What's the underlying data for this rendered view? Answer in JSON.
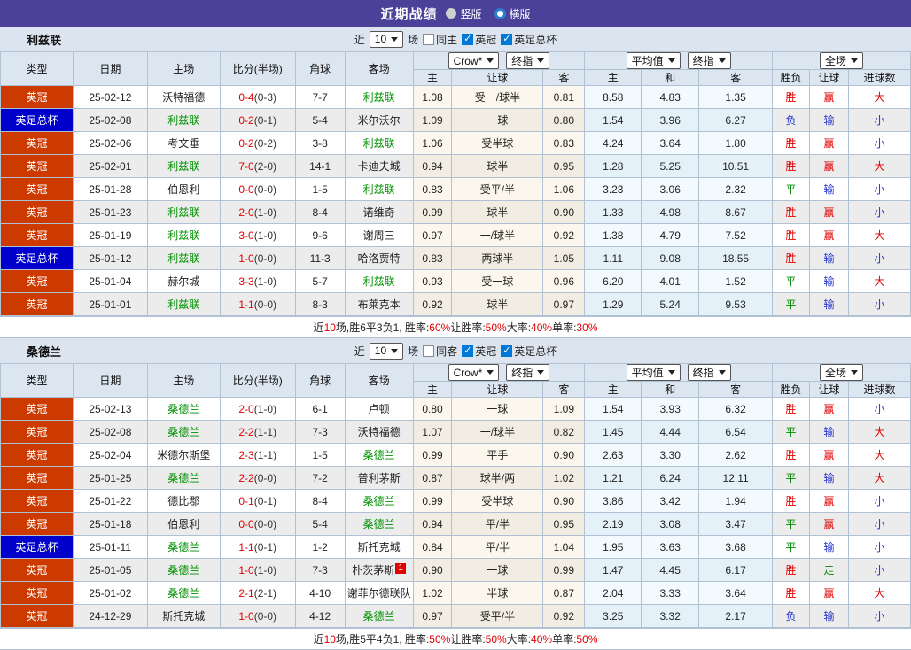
{
  "topbar": {
    "title": "近期战绩",
    "radios": [
      {
        "label": "竖版",
        "selected": false
      },
      {
        "label": "横版",
        "selected": true
      }
    ]
  },
  "colors": {
    "topbar_purple": "#4c4199",
    "league_badge": "#cc3a00",
    "cup_badge": "#0000cc",
    "win_red": "#e00000",
    "draw_green": "#008800",
    "lose_blue": "#2233cc",
    "highlight_team_green": "#009000",
    "checkbox_blue": "#0078d7"
  },
  "columns": [
    "类型",
    "日期",
    "主场",
    "比分(半场)",
    "角球",
    "客场",
    "主",
    "让球",
    "客",
    "主",
    "和",
    "客",
    "胜负",
    "让球",
    "进球数"
  ],
  "selects": {
    "odds_source": "Crow*",
    "odds_stage": "终指",
    "average": "平均值",
    "average_stage": "终指",
    "scope": "全场"
  },
  "sections": [
    {
      "team": "利兹联",
      "filter": {
        "near_label": "近",
        "count": "10",
        "games_label": "场",
        "checks": [
          {
            "label": "同主",
            "checked": false
          },
          {
            "label": "英冠",
            "checked": true
          },
          {
            "label": "英足总杯",
            "checked": true
          }
        ]
      },
      "rows": [
        {
          "comp": "英冠",
          "comp_type": "league",
          "date": "25-02-12",
          "home": "沃特福德",
          "home_hl": false,
          "score": "0-4",
          "half": "(0-3)",
          "corner": "7-7",
          "away": "利兹联",
          "away_hl": true,
          "odds": [
            "1.08",
            "受一/球半",
            "0.81",
            "8.58",
            "4.83",
            "1.35"
          ],
          "results": [
            [
              "胜",
              "r"
            ],
            [
              "赢",
              "r"
            ],
            [
              "大",
              "r"
            ]
          ]
        },
        {
          "comp": "英足总杯",
          "comp_type": "cup",
          "date": "25-02-08",
          "home": "利兹联",
          "home_hl": true,
          "score": "0-2",
          "half": "(0-1)",
          "corner": "5-4",
          "away": "米尔沃尔",
          "away_hl": false,
          "odds": [
            "1.09",
            "一球",
            "0.80",
            "1.54",
            "3.96",
            "6.27"
          ],
          "results": [
            [
              "负",
              "b"
            ],
            [
              "输",
              "b"
            ],
            [
              "小",
              "b"
            ]
          ]
        },
        {
          "comp": "英冠",
          "comp_type": "league",
          "date": "25-02-06",
          "home": "考文垂",
          "home_hl": false,
          "score": "0-2",
          "half": "(0-2)",
          "corner": "3-8",
          "away": "利兹联",
          "away_hl": true,
          "odds": [
            "1.06",
            "受半球",
            "0.83",
            "4.24",
            "3.64",
            "1.80"
          ],
          "results": [
            [
              "胜",
              "r"
            ],
            [
              "赢",
              "r"
            ],
            [
              "小",
              "b"
            ]
          ]
        },
        {
          "comp": "英冠",
          "comp_type": "league",
          "date": "25-02-01",
          "home": "利兹联",
          "home_hl": true,
          "score": "7-0",
          "half": "(2-0)",
          "corner": "14-1",
          "away": "卡迪夫城",
          "away_hl": false,
          "odds": [
            "0.94",
            "球半",
            "0.95",
            "1.28",
            "5.25",
            "10.51"
          ],
          "results": [
            [
              "胜",
              "r"
            ],
            [
              "赢",
              "r"
            ],
            [
              "大",
              "r"
            ]
          ]
        },
        {
          "comp": "英冠",
          "comp_type": "league",
          "date": "25-01-28",
          "home": "伯恩利",
          "home_hl": false,
          "score": "0-0",
          "half": "(0-0)",
          "corner": "1-5",
          "away": "利兹联",
          "away_hl": true,
          "odds": [
            "0.83",
            "受平/半",
            "1.06",
            "3.23",
            "3.06",
            "2.32"
          ],
          "results": [
            [
              "平",
              "g"
            ],
            [
              "输",
              "b"
            ],
            [
              "小",
              "b"
            ]
          ]
        },
        {
          "comp": "英冠",
          "comp_type": "league",
          "date": "25-01-23",
          "home": "利兹联",
          "home_hl": true,
          "score": "2-0",
          "half": "(1-0)",
          "corner": "8-4",
          "away": "诺维奇",
          "away_hl": false,
          "odds": [
            "0.99",
            "球半",
            "0.90",
            "1.33",
            "4.98",
            "8.67"
          ],
          "results": [
            [
              "胜",
              "r"
            ],
            [
              "赢",
              "r"
            ],
            [
              "小",
              "b"
            ]
          ]
        },
        {
          "comp": "英冠",
          "comp_type": "league",
          "date": "25-01-19",
          "home": "利兹联",
          "home_hl": true,
          "score": "3-0",
          "half": "(1-0)",
          "corner": "9-6",
          "away": "谢周三",
          "away_hl": false,
          "odds": [
            "0.97",
            "一/球半",
            "0.92",
            "1.38",
            "4.79",
            "7.52"
          ],
          "results": [
            [
              "胜",
              "r"
            ],
            [
              "赢",
              "r"
            ],
            [
              "大",
              "r"
            ]
          ]
        },
        {
          "comp": "英足总杯",
          "comp_type": "cup",
          "date": "25-01-12",
          "home": "利兹联",
          "home_hl": true,
          "score": "1-0",
          "half": "(0-0)",
          "corner": "11-3",
          "away": "哈洛贾特",
          "away_hl": false,
          "odds": [
            "0.83",
            "两球半",
            "1.05",
            "1.11",
            "9.08",
            "18.55"
          ],
          "results": [
            [
              "胜",
              "r"
            ],
            [
              "输",
              "b"
            ],
            [
              "小",
              "b"
            ]
          ]
        },
        {
          "comp": "英冠",
          "comp_type": "league",
          "date": "25-01-04",
          "home": "赫尔城",
          "home_hl": false,
          "score": "3-3",
          "half": "(1-0)",
          "corner": "5-7",
          "away": "利兹联",
          "away_hl": true,
          "odds": [
            "0.93",
            "受一球",
            "0.96",
            "6.20",
            "4.01",
            "1.52"
          ],
          "results": [
            [
              "平",
              "g"
            ],
            [
              "输",
              "b"
            ],
            [
              "大",
              "r"
            ]
          ]
        },
        {
          "comp": "英冠",
          "comp_type": "league",
          "date": "25-01-01",
          "home": "利兹联",
          "home_hl": true,
          "score": "1-1",
          "half": "(0-0)",
          "corner": "8-3",
          "away": "布莱克本",
          "away_hl": false,
          "odds": [
            "0.92",
            "球半",
            "0.97",
            "1.29",
            "5.24",
            "9.53"
          ],
          "results": [
            [
              "平",
              "g"
            ],
            [
              "输",
              "b"
            ],
            [
              "小",
              "b"
            ]
          ]
        }
      ],
      "summary": [
        [
          "近",
          "k"
        ],
        [
          "10",
          "r"
        ],
        [
          "场,胜6平3负1, 胜率:",
          "k"
        ],
        [
          "60%",
          "r"
        ],
        [
          " 让胜率:",
          "k"
        ],
        [
          "50%",
          "r"
        ],
        [
          " 大率:",
          "k"
        ],
        [
          "40%",
          "r"
        ],
        [
          " 单率:",
          "k"
        ],
        [
          "30%",
          "r"
        ]
      ]
    },
    {
      "team": "桑德兰",
      "filter": {
        "near_label": "近",
        "count": "10",
        "games_label": "场",
        "checks": [
          {
            "label": "同客",
            "checked": false
          },
          {
            "label": "英冠",
            "checked": true
          },
          {
            "label": "英足总杯",
            "checked": true
          }
        ]
      },
      "rows": [
        {
          "comp": "英冠",
          "comp_type": "league",
          "date": "25-02-13",
          "home": "桑德兰",
          "home_hl": true,
          "score": "2-0",
          "half": "(1-0)",
          "corner": "6-1",
          "away": "卢顿",
          "away_hl": false,
          "odds": [
            "0.80",
            "一球",
            "1.09",
            "1.54",
            "3.93",
            "6.32"
          ],
          "results": [
            [
              "胜",
              "r"
            ],
            [
              "赢",
              "r"
            ],
            [
              "小",
              "b"
            ]
          ]
        },
        {
          "comp": "英冠",
          "comp_type": "league",
          "date": "25-02-08",
          "home": "桑德兰",
          "home_hl": true,
          "score": "2-2",
          "half": "(1-1)",
          "corner": "7-3",
          "away": "沃特福德",
          "away_hl": false,
          "odds": [
            "1.07",
            "一/球半",
            "0.82",
            "1.45",
            "4.44",
            "6.54"
          ],
          "results": [
            [
              "平",
              "g"
            ],
            [
              "输",
              "b"
            ],
            [
              "大",
              "r"
            ]
          ]
        },
        {
          "comp": "英冠",
          "comp_type": "league",
          "date": "25-02-04",
          "home": "米德尔斯堡",
          "home_hl": false,
          "score": "2-3",
          "half": "(1-1)",
          "corner": "1-5",
          "away": "桑德兰",
          "away_hl": true,
          "odds": [
            "0.99",
            "平手",
            "0.90",
            "2.63",
            "3.30",
            "2.62"
          ],
          "results": [
            [
              "胜",
              "r"
            ],
            [
              "赢",
              "r"
            ],
            [
              "大",
              "r"
            ]
          ]
        },
        {
          "comp": "英冠",
          "comp_type": "league",
          "date": "25-01-25",
          "home": "桑德兰",
          "home_hl": true,
          "score": "2-2",
          "half": "(0-0)",
          "corner": "7-2",
          "away": "普利茅斯",
          "away_hl": false,
          "odds": [
            "0.87",
            "球半/两",
            "1.02",
            "1.21",
            "6.24",
            "12.11"
          ],
          "results": [
            [
              "平",
              "g"
            ],
            [
              "输",
              "b"
            ],
            [
              "大",
              "r"
            ]
          ]
        },
        {
          "comp": "英冠",
          "comp_type": "league",
          "date": "25-01-22",
          "home": "德比郡",
          "home_hl": false,
          "score": "0-1",
          "half": "(0-1)",
          "corner": "8-4",
          "away": "桑德兰",
          "away_hl": true,
          "odds": [
            "0.99",
            "受半球",
            "0.90",
            "3.86",
            "3.42",
            "1.94"
          ],
          "results": [
            [
              "胜",
              "r"
            ],
            [
              "赢",
              "r"
            ],
            [
              "小",
              "b"
            ]
          ]
        },
        {
          "comp": "英冠",
          "comp_type": "league",
          "date": "25-01-18",
          "home": "伯恩利",
          "home_hl": false,
          "score": "0-0",
          "half": "(0-0)",
          "corner": "5-4",
          "away": "桑德兰",
          "away_hl": true,
          "odds": [
            "0.94",
            "平/半",
            "0.95",
            "2.19",
            "3.08",
            "3.47"
          ],
          "results": [
            [
              "平",
              "g"
            ],
            [
              "赢",
              "r"
            ],
            [
              "小",
              "b"
            ]
          ]
        },
        {
          "comp": "英足总杯",
          "comp_type": "cup",
          "date": "25-01-11",
          "home": "桑德兰",
          "home_hl": true,
          "score": "1-1",
          "half": "(0-1)",
          "corner": "1-2",
          "away": "斯托克城",
          "away_hl": false,
          "odds": [
            "0.84",
            "平/半",
            "1.04",
            "1.95",
            "3.63",
            "3.68"
          ],
          "results": [
            [
              "平",
              "g"
            ],
            [
              "输",
              "b"
            ],
            [
              "小",
              "b"
            ]
          ]
        },
        {
          "comp": "英冠",
          "comp_type": "league",
          "date": "25-01-05",
          "home": "桑德兰",
          "home_hl": true,
          "score": "1-0",
          "half": "(1-0)",
          "corner": "7-3",
          "away": "朴茨茅斯",
          "away_hl": false,
          "away_badge": "1",
          "odds": [
            "0.90",
            "一球",
            "0.99",
            "1.47",
            "4.45",
            "6.17"
          ],
          "results": [
            [
              "胜",
              "r"
            ],
            [
              "走",
              "g"
            ],
            [
              "小",
              "b"
            ]
          ]
        },
        {
          "comp": "英冠",
          "comp_type": "league",
          "date": "25-01-02",
          "home": "桑德兰",
          "home_hl": true,
          "score": "2-1",
          "half": "(2-1)",
          "corner": "4-10",
          "away": "谢菲尔德联队",
          "away_hl": false,
          "odds": [
            "1.02",
            "半球",
            "0.87",
            "2.04",
            "3.33",
            "3.64"
          ],
          "results": [
            [
              "胜",
              "r"
            ],
            [
              "赢",
              "r"
            ],
            [
              "大",
              "r"
            ]
          ]
        },
        {
          "comp": "英冠",
          "comp_type": "league",
          "date": "24-12-29",
          "home": "斯托克城",
          "home_hl": false,
          "score": "1-0",
          "half": "(0-0)",
          "corner": "4-12",
          "away": "桑德兰",
          "away_hl": true,
          "odds": [
            "0.97",
            "受平/半",
            "0.92",
            "3.25",
            "3.32",
            "2.17"
          ],
          "results": [
            [
              "负",
              "b"
            ],
            [
              "输",
              "b"
            ],
            [
              "小",
              "b"
            ]
          ]
        }
      ],
      "summary": [
        [
          "近",
          "k"
        ],
        [
          "10",
          "r"
        ],
        [
          "场,胜5平4负1, 胜率:",
          "k"
        ],
        [
          "50%",
          "r"
        ],
        [
          " 让胜率:",
          "k"
        ],
        [
          "50%",
          "r"
        ],
        [
          " 大率:",
          "k"
        ],
        [
          "40%",
          "r"
        ],
        [
          " 单率:",
          "k"
        ],
        [
          "50%",
          "r"
        ]
      ]
    }
  ]
}
